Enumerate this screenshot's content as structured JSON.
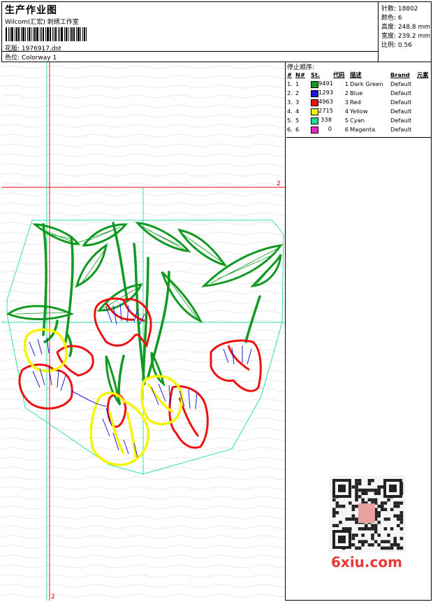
{
  "header": {
    "title": "生产作业图",
    "software": "Wilcom(汇宏) 刺绣工作室",
    "file_label": "花版:",
    "file_name": "1976917.dst",
    "color_label": "色位:",
    "colorway": "Colorway 1"
  },
  "stats": {
    "stitches": "针数: 18802",
    "colors": "颜色: 6",
    "height": "高度: 248.8 mm",
    "width": "宽度: 239.2 mm",
    "ratio": "比例: 0.56"
  },
  "stop_sequence": {
    "title": "停止顺序:",
    "columns": [
      "#",
      "N#",
      "St.",
      "代码",
      "描述",
      "Brand",
      "元素"
    ],
    "rows": [
      {
        "num": "1.",
        "n": "1",
        "color": "#119922",
        "st": "9491",
        "code": "1",
        "desc": "Dark Green",
        "brand": "Default"
      },
      {
        "num": "2.",
        "n": "2",
        "color": "#1a1add",
        "st": "1293",
        "code": "2",
        "desc": "Blue",
        "brand": "Default"
      },
      {
        "num": "3.",
        "n": "3",
        "color": "#ee1111",
        "st": "4963",
        "code": "3",
        "desc": "Red",
        "brand": "Default"
      },
      {
        "num": "4.",
        "n": "4",
        "color": "#f5f500",
        "st": "2715",
        "code": "4",
        "desc": "Yellow",
        "brand": "Default"
      },
      {
        "num": "5.",
        "n": "5",
        "color": "#22dd99",
        "st": "338",
        "code": "5",
        "desc": "Cyan",
        "brand": "Default"
      },
      {
        "num": "6.",
        "n": "6",
        "color": "#ee22cc",
        "st": "0",
        "code": "6",
        "desc": "Magenta",
        "brand": "Default"
      }
    ]
  },
  "canvas": {
    "guide_label_h": "2",
    "guide_label_v": "2"
  },
  "watermark": {
    "text": "6xiu.com"
  },
  "colors": {
    "guide_red": "#ff0000",
    "guide_cyan": "#33ddaa",
    "stem_green": "#119922",
    "petal_red": "#ee1111",
    "petal_yellow": "#f5f500",
    "detail_blue": "#1a1add"
  }
}
